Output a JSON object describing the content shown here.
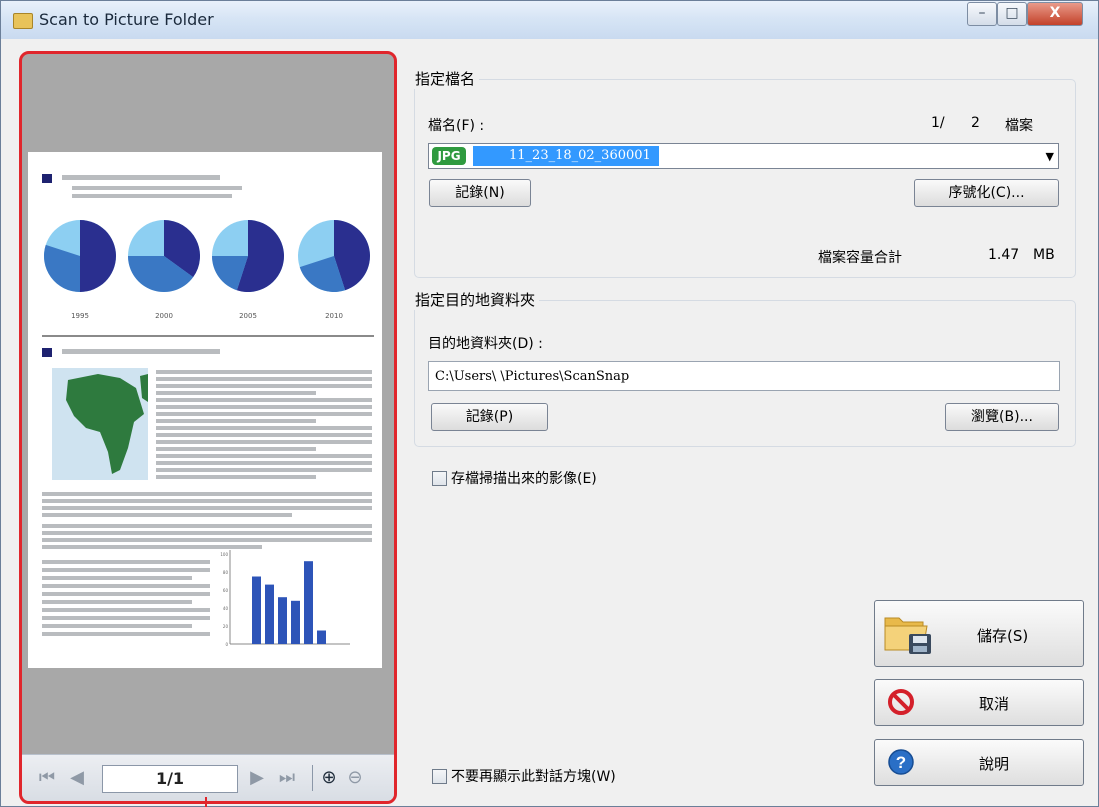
{
  "window": {
    "title": "Scan to Picture Folder",
    "controls": {
      "minimize": "–",
      "maximize": "□",
      "close": "X"
    }
  },
  "preview": {
    "page_indicator": "1/1",
    "document": {
      "pie_years": [
        "1995",
        "2000",
        "2005",
        "2010"
      ],
      "bar_axis_ticks": [
        "100",
        "80",
        "60",
        "40",
        "20",
        "0"
      ],
      "bar_values": [
        75,
        66,
        52,
        48,
        92,
        15
      ],
      "colors": {
        "dark_blue": "#2a2f8f",
        "mid_blue": "#3a78c4",
        "light_blue": "#8dcff2",
        "map_green": "#2e7a3e",
        "map_sea": "#cfe3f0",
        "text_line": "#b9bcbf"
      }
    }
  },
  "filename_group": {
    "title": "指定檔名",
    "filename_label": "檔名(F) :",
    "count_value": "1/",
    "count_total": "2",
    "count_unit": "檔案",
    "file_badge": "JPG",
    "filename_value": "11_23_18_02_360001",
    "record_button": "記錄(N)",
    "serialize_button": "序號化(C)...",
    "total_size_label": "檔案容量合計",
    "total_size_value": "1.47",
    "total_size_unit": "MB"
  },
  "destination_group": {
    "title": "指定目的地資料夾",
    "folder_label": "目的地資料夾(D) :",
    "folder_path": "C:\\Users\\     \\Pictures\\ScanSnap",
    "record_button": "記錄(P)",
    "browse_button": "瀏覽(B)..."
  },
  "options": {
    "save_scanned_image": "存檔掃描出來的影像(E)",
    "dont_show_again": "不要再顯示此對話方塊(W)"
  },
  "actions": {
    "save": "儲存(S)",
    "cancel": "取消",
    "help": "說明"
  }
}
